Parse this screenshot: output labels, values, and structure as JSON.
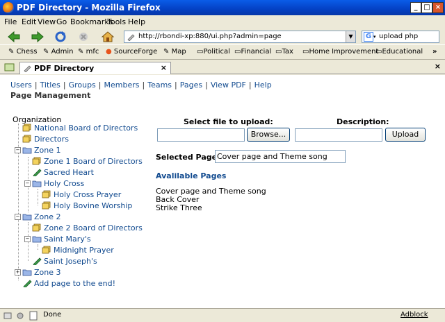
{
  "window": {
    "title": "PDF Directory - Mozilla Firefox"
  },
  "menu": [
    "File",
    "Edit",
    "View",
    "Go",
    "Bookmarks",
    "Tools",
    "Help"
  ],
  "url": "http://rbondi-xp:880/ui.php?admin=page",
  "search": {
    "value": "upload php"
  },
  "bookmarks": [
    "Chess",
    "Admin",
    "mfc",
    "SourceForge",
    "Map",
    "Political",
    "Financial",
    "Tax",
    "Home Improvement",
    "Educational"
  ],
  "overflow": "»",
  "tab": {
    "label": "PDF Directory",
    "close": "×"
  },
  "nav": [
    "Users",
    "Titles",
    "Groups",
    "Members",
    "Teams",
    "Pages",
    "View PDF",
    "Help"
  ],
  "nav_sep": "|",
  "page_title": "Page Management",
  "tree": {
    "root": "Organization",
    "nodes": [
      {
        "label": "National Board of Directors"
      },
      {
        "label": "Directors"
      },
      {
        "label": "Zone 1",
        "toggle": "−"
      },
      {
        "label": "Zone 1 Board of Directors"
      },
      {
        "label": "Sacred Heart"
      },
      {
        "label": "Holy Cross",
        "toggle": "−"
      },
      {
        "label": "Holy Cross Prayer"
      },
      {
        "label": "Holy Bovine Worship"
      },
      {
        "label": "Zone 2",
        "toggle": "−"
      },
      {
        "label": "Zone 2 Board of Directors"
      },
      {
        "label": "Saint Mary's",
        "toggle": "−"
      },
      {
        "label": "Midnight Prayer"
      },
      {
        "label": "Saint Joseph's"
      },
      {
        "label": "Zone 3",
        "toggle": "+"
      },
      {
        "label": "Add page to the end!"
      }
    ]
  },
  "upload": {
    "file_label": "Select file to upload:",
    "desc_label": "Description:",
    "browse": "Browse...",
    "upload": "Upload",
    "file_value": "",
    "desc_value": ""
  },
  "selected": {
    "label": "Selected Page:",
    "value": "Cover page and Theme song"
  },
  "available": {
    "heading": "Avalilable Pages",
    "items": [
      "Cover page and Theme song",
      "Back Cover",
      "Strike Three"
    ]
  },
  "status": {
    "text": "Done",
    "adblock": "Adblock"
  }
}
